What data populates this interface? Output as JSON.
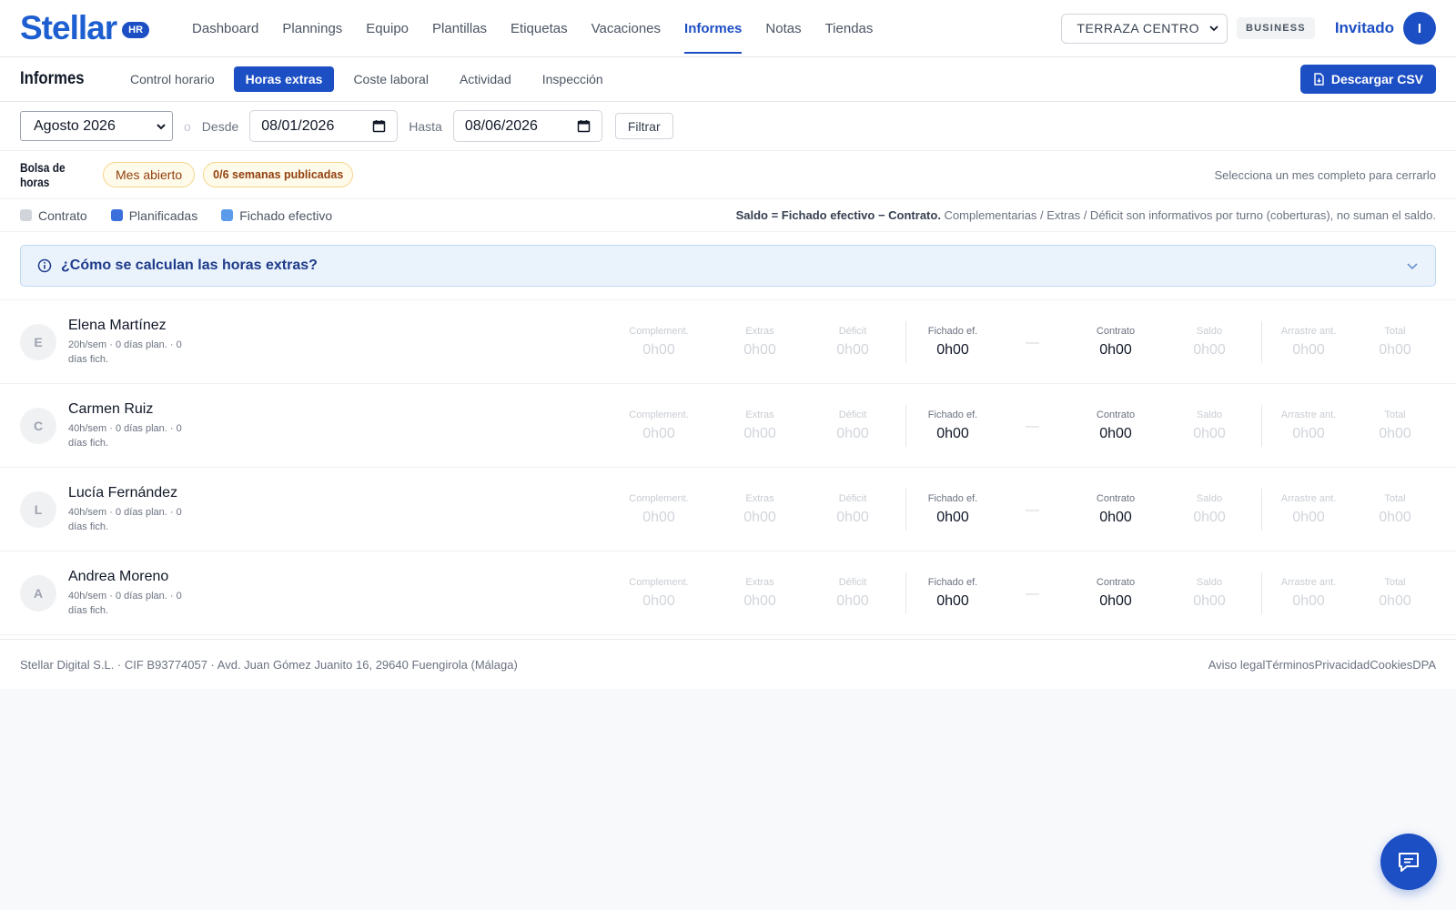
{
  "brand": {
    "name": "Stellar",
    "badge": "HR"
  },
  "nav": {
    "items": [
      {
        "label": "Dashboard"
      },
      {
        "label": "Plannings"
      },
      {
        "label": "Equipo"
      },
      {
        "label": "Plantillas"
      },
      {
        "label": "Etiquetas"
      },
      {
        "label": "Vacaciones"
      },
      {
        "label": "Informes",
        "active": true
      },
      {
        "label": "Notas"
      },
      {
        "label": "Tiendas"
      }
    ]
  },
  "topbar": {
    "store_select": "TERRAZA CENTRO",
    "plan_badge": "BUSINESS",
    "user_name": "Invitado",
    "user_initial": "I"
  },
  "subbar": {
    "title": "Informes",
    "tabs": [
      {
        "label": "Control horario"
      },
      {
        "label": "Horas extras",
        "active": true
      },
      {
        "label": "Coste laboral"
      },
      {
        "label": "Actividad"
      },
      {
        "label": "Inspección"
      }
    ],
    "download_label": "Descargar CSV"
  },
  "filters": {
    "month": "Agosto 2026",
    "separator": "o",
    "from_label": "Desde",
    "from_value": "08/01/2026",
    "to_label": "Hasta",
    "to_value": "08/06/2026",
    "filter_label": "Filtrar"
  },
  "bolsa": {
    "title": "Bolsa de horas",
    "status": "Mes abierto",
    "weeks": "0/6 semanas publicadas",
    "hint": "Selecciona un mes completo para cerrarlo"
  },
  "legend": {
    "items": [
      {
        "label": "Contrato",
        "color": "#d1d5db"
      },
      {
        "label": "Planificadas",
        "color": "#3b6fdc"
      },
      {
        "label": "Fichado efectivo",
        "color": "#5b9bea"
      }
    ],
    "note_bold": "Saldo = Fichado efectivo − Contrato.",
    "note_rest": " Complementarias / Extras / Déficit son informativos por turno (coberturas), no suman el saldo."
  },
  "info": {
    "title": "¿Cómo se calculan las horas extras?"
  },
  "metric_labels": {
    "complement": "Complement.",
    "extras": "Extras",
    "deficit": "Déficit",
    "fichado": "Fichado ef.",
    "contrato": "Contrato",
    "saldo": "Saldo",
    "arrastre": "Arrastre ant.",
    "total": "Total"
  },
  "employees": [
    {
      "initial": "E",
      "name": "Elena Martínez",
      "meta_line1": "20h/sem · 0 días plan. · 0",
      "meta_line2": "días fich.",
      "complement": "0h00",
      "extras": "0h00",
      "deficit": "0h00",
      "fichado": "0h00",
      "dash": "—",
      "contrato": "0h00",
      "saldo": "0h00",
      "arrastre": "0h00",
      "total": "0h00"
    },
    {
      "initial": "C",
      "name": "Carmen Ruiz",
      "meta_line1": "40h/sem · 0 días plan. · 0",
      "meta_line2": "días fich.",
      "complement": "0h00",
      "extras": "0h00",
      "deficit": "0h00",
      "fichado": "0h00",
      "dash": "—",
      "contrato": "0h00",
      "saldo": "0h00",
      "arrastre": "0h00",
      "total": "0h00"
    },
    {
      "initial": "L",
      "name": "Lucía Fernández",
      "meta_line1": "40h/sem · 0 días plan. · 0",
      "meta_line2": "días fich.",
      "complement": "0h00",
      "extras": "0h00",
      "deficit": "0h00",
      "fichado": "0h00",
      "dash": "—",
      "contrato": "0h00",
      "saldo": "0h00",
      "arrastre": "0h00",
      "total": "0h00"
    },
    {
      "initial": "A",
      "name": "Andrea Moreno",
      "meta_line1": "40h/sem · 0 días plan. · 0",
      "meta_line2": "días fich.",
      "complement": "0h00",
      "extras": "0h00",
      "deficit": "0h00",
      "fichado": "0h00",
      "dash": "—",
      "contrato": "0h00",
      "saldo": "0h00",
      "arrastre": "0h00",
      "total": "0h00"
    }
  ],
  "footer": {
    "company": "Stellar Digital S.L. · CIF B93774057 · Avd. Juan Gómez Juanito 16, 29640 Fuengirola (Málaga)",
    "links": [
      {
        "label": "Aviso legal"
      },
      {
        "label": "Términos"
      },
      {
        "label": "Privacidad"
      },
      {
        "label": "Cookies"
      },
      {
        "label": "DPA"
      }
    ]
  },
  "icons": {
    "info": "info-circle-icon",
    "chevron": "chevron-down-icon",
    "csv": "file-icon",
    "chat": "chat-icon",
    "calendar": "calendar-icon"
  }
}
